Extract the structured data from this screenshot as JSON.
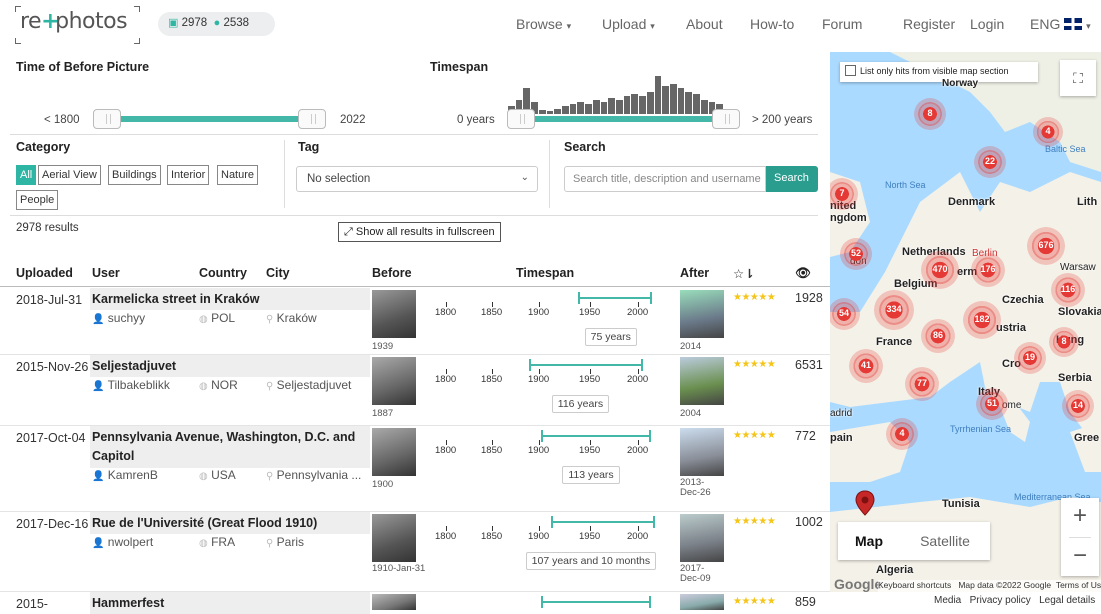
{
  "nav": {
    "logo_left": "re",
    "logo_cross": "+",
    "logo_right": "photos",
    "photo_count": "2978",
    "user_count": "2538",
    "browse": "Browse",
    "upload": "Upload",
    "about": "About",
    "howto": "How-to",
    "forum": "Forum",
    "register": "Register",
    "login": "Login",
    "language": "ENG"
  },
  "filters": {
    "time_title": "Time of Before Picture",
    "time_min": "< 1800",
    "time_max": "2022",
    "timespan_title": "Timespan",
    "span_min": "0 years",
    "span_max": "> 200 years",
    "category_title": "Category",
    "categories": [
      "All",
      "Aerial View",
      "Buildings",
      "Interior",
      "Nature",
      "People"
    ],
    "tag_title": "Tag",
    "tag_value": "No selection",
    "search_title": "Search",
    "search_placeholder": "Search title, description and username",
    "search_button": "Search",
    "results": "2978 results",
    "fullscreen": "Show all results in fullscreen"
  },
  "table": {
    "headers": {
      "uploaded": "Uploaded",
      "user": "User",
      "country": "Country",
      "city": "City",
      "before": "Before",
      "timespan": "Timespan",
      "after": "After"
    },
    "axis": [
      "1800",
      "1850",
      "1900",
      "1950",
      "2000"
    ],
    "rows": [
      {
        "date": "2018-Jul-31",
        "title": "Karmelicka street in Kraków",
        "user": "suchyy",
        "country": "POL",
        "city": "Kraków",
        "before_year": "1939",
        "after_year": "2014",
        "span": "75 years",
        "views": "1928",
        "start": 1939,
        "end": 2014
      },
      {
        "date": "2015-Nov-26",
        "title": "Seljestadjuvet",
        "user": "Tilbakeblikk",
        "country": "NOR",
        "city": "Seljestadjuvet",
        "before_year": "1887",
        "after_year": "2004",
        "span": "116 years",
        "views": "6531",
        "start": 1887,
        "end": 2004
      },
      {
        "date": "2017-Oct-04",
        "title": "Pennsylvania Avenue, Washington, D.C. and Capitol",
        "user": "KamrenB",
        "country": "USA",
        "city": "Pennsylvania ...",
        "before_year": "1900",
        "after_year": "2013-Dec-26",
        "span": "113 years",
        "views": "772",
        "start": 1900,
        "end": 2013
      },
      {
        "date": "2017-Dec-16",
        "title": "Rue de l'Université (Great Flood 1910)",
        "user": "nwolpert",
        "country": "FRA",
        "city": "Paris",
        "before_year": "1910-Jan-31",
        "after_year": "2017-Dec-09",
        "span": "107 years and 10 months",
        "views": "1002",
        "start": 1910,
        "end": 2017
      },
      {
        "date": "2015-",
        "title": "Hammerfest",
        "user": "",
        "country": "",
        "city": "",
        "before_year": "",
        "after_year": "",
        "span": "",
        "views": "859",
        "start": 1900,
        "end": 2013
      }
    ]
  },
  "map": {
    "visible_only": "List only hits from visible map section",
    "map_btn": "Map",
    "satellite_btn": "Satellite",
    "attribution_keyboard": "Keyboard shortcuts",
    "attribution_data": "Map data ©2022 Google",
    "attribution_terms": "Terms of Use",
    "google": "Google",
    "labels": {
      "norway": "Norway",
      "north_sea": "North Sea",
      "denmark": "Denmark",
      "lith": "Lith",
      "united_kingdom_a": "nited",
      "united_kingdom_b": "ngdom",
      "netherlands": "Netherlands",
      "berlin": "Berlin",
      "warsaw": "Warsaw",
      "belgium": "Belgium",
      "germany": "erm",
      "london": "don",
      "czechia": "Czechia",
      "slovakia": "Slovakia",
      "austria": "ustria",
      "france": "France",
      "hungary": "Hung",
      "croatia": "Cro",
      "serbia": "Serbia",
      "italy": "Italy",
      "rome": "ome",
      "madrid": "adrid",
      "spain": "pain",
      "tyrrhenian": "Tyrrhenian Sea",
      "greece": "Gree",
      "baltic": "Baltic Sea",
      "tunisia": "Tunisia",
      "algeria": "Algeria",
      "mediterranean": "Mediterranean Sea"
    },
    "clusters": [
      "8",
      "4",
      "22",
      "7",
      "676",
      "52",
      "470",
      "176",
      "116",
      "334",
      "54",
      "182",
      "86",
      "8",
      "19",
      "41",
      "77",
      "51",
      "14",
      "4"
    ]
  },
  "footer": {
    "media": "Media",
    "privacy": "Privacy policy",
    "legal": "Legal details"
  },
  "colors": {
    "accent": "#2fb5a4",
    "cluster": "#e53935",
    "star": "#f5c518"
  }
}
